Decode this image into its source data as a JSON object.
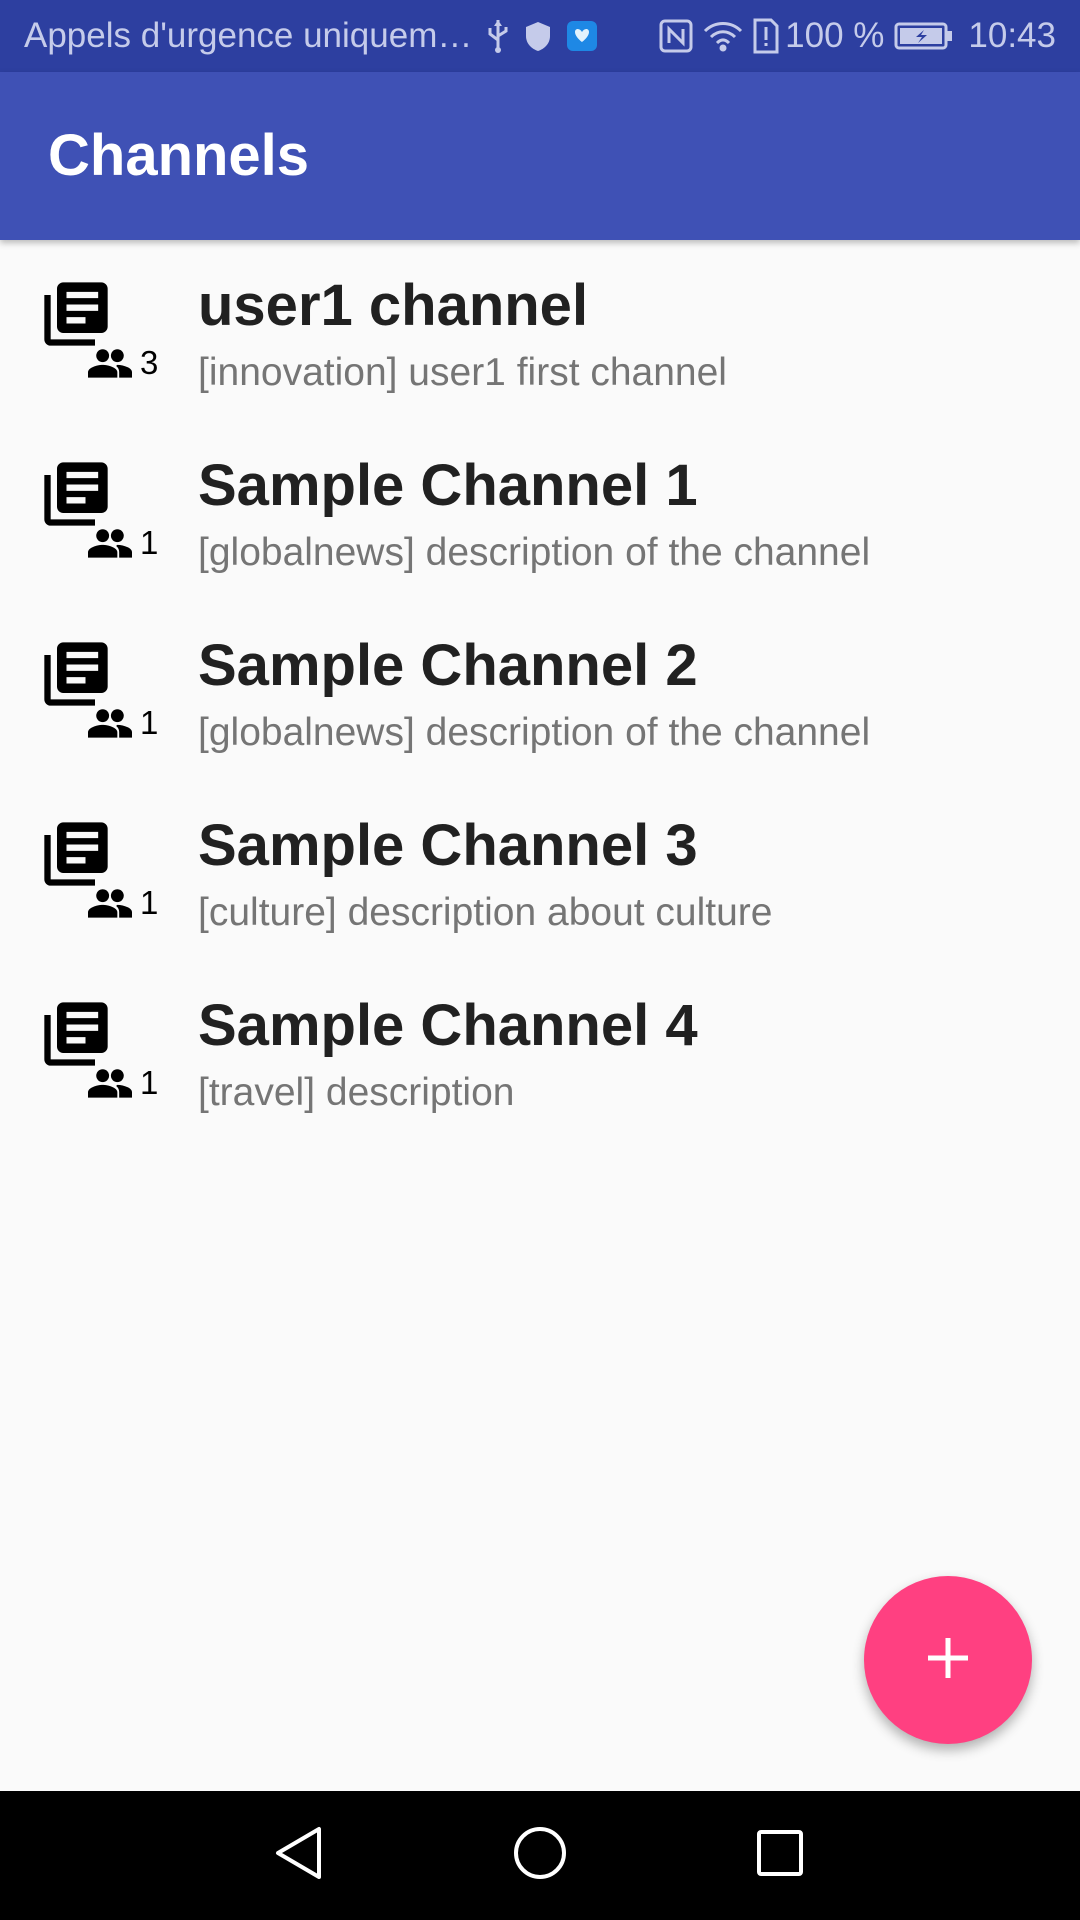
{
  "status_bar": {
    "carrier_text": "Appels d'urgence uniquem…",
    "battery_percent": "100 %",
    "time": "10:43",
    "left_icons": [
      "usb-icon",
      "shield-icon",
      "app-notification-icon"
    ],
    "right_icons": [
      "nfc-icon",
      "wifi-icon",
      "sim-alert-icon",
      "battery-charging-icon"
    ]
  },
  "app_bar": {
    "title": "Channels",
    "color": "#3F51B5"
  },
  "channels": [
    {
      "title": "user1 channel",
      "description": "[innovation] user1 first channel",
      "members": "3"
    },
    {
      "title": "Sample Channel 1",
      "description": "[globalnews] description of the channel",
      "members": "1"
    },
    {
      "title": "Sample Channel 2",
      "description": "[globalnews] description of the channel",
      "members": "1"
    },
    {
      "title": "Sample Channel 3",
      "description": "[culture] description about culture",
      "members": "1"
    },
    {
      "title": "Sample Channel 4",
      "description": "[travel] description",
      "members": "1"
    }
  ],
  "list_icons": {
    "channel": "library-books-icon",
    "members": "people-icon"
  },
  "fab": {
    "icon": "plus-icon",
    "color": "#FF4081"
  },
  "nav_bar": {
    "buttons": [
      "back-triangle-icon",
      "home-circle-icon",
      "recents-square-icon"
    ]
  }
}
